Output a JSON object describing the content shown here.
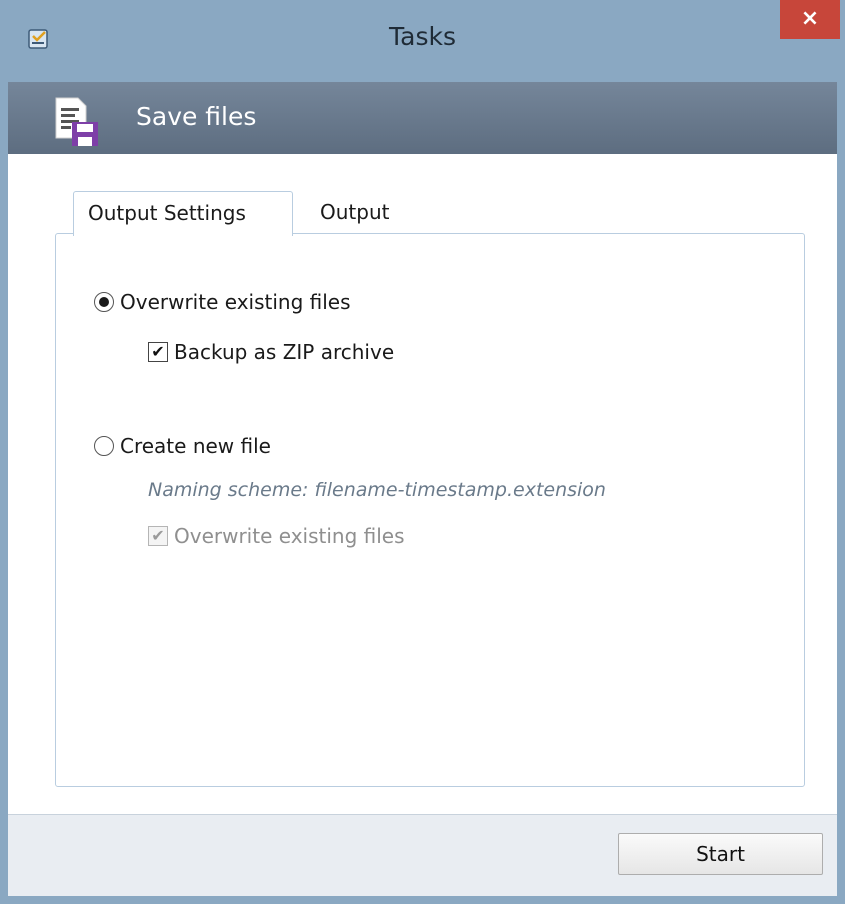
{
  "window": {
    "title": "Tasks",
    "close_label": "×"
  },
  "header": {
    "title": "Save files"
  },
  "tabs": [
    {
      "label": "Output Settings",
      "active": true
    },
    {
      "label": "Output",
      "active": false
    }
  ],
  "options": {
    "overwrite": {
      "label": "Overwrite existing files",
      "checked": true
    },
    "backup_zip": {
      "label": "Backup as ZIP archive",
      "checked": true
    },
    "create_new": {
      "label": "Create new file",
      "checked": false
    },
    "naming_scheme": "Naming scheme: filename-timestamp.extension",
    "overwrite_new": {
      "label": "Overwrite existing files",
      "checked": true,
      "disabled": true
    }
  },
  "footer": {
    "start_label": "Start"
  },
  "colors": {
    "titlebar": "#8aa8c2",
    "header": "#5d6d80",
    "close": "#c7463a"
  },
  "icons": {
    "app": "tasks-app-icon",
    "header": "save-files-icon"
  }
}
